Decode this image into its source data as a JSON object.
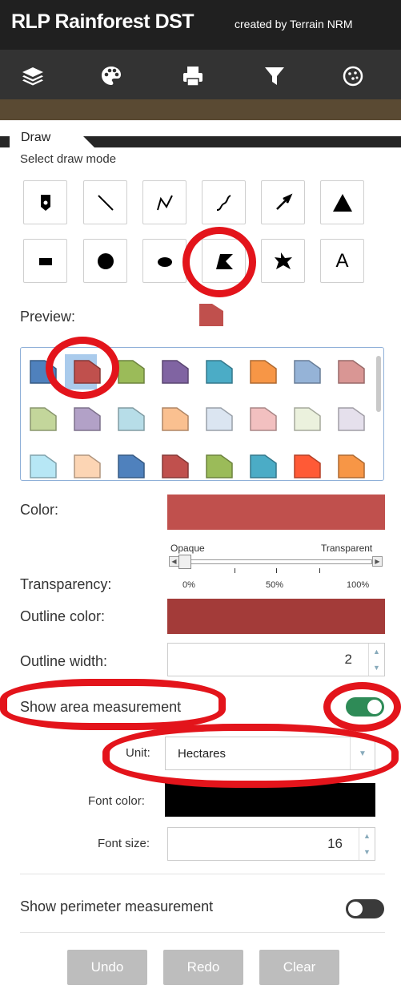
{
  "header": {
    "title": "RLP Rainforest DST",
    "credit": "created by Terrain NRM"
  },
  "toolbar": {
    "icons": [
      "layers-icon",
      "palette-icon",
      "print-icon",
      "filter-icon",
      "analysis-icon"
    ]
  },
  "tab": {
    "label": "Draw"
  },
  "draw": {
    "select_mode_label": "Select draw mode",
    "tools_row1": [
      "point",
      "line",
      "polyline",
      "freehand-polyline",
      "arrow",
      "triangle"
    ],
    "tools_row2": [
      "rectangle",
      "circle",
      "ellipse",
      "polygon",
      "freehand-polygon",
      "text"
    ],
    "text_tool_label": "A",
    "selected_tool": "polygon"
  },
  "preview": {
    "label": "Preview:",
    "color": "#c0504d"
  },
  "swatches": {
    "selected_index": 1,
    "colors": [
      "#4f81bd",
      "#c0504d",
      "#9bbb59",
      "#8064a2",
      "#4bacc6",
      "#f79646",
      "#95b3d7",
      "#d99694",
      "#c3d69b",
      "#b2a1c7",
      "#b7dde8",
      "#fac090",
      "#dbe5f1",
      "#f2c0c0",
      "#ebf1dd",
      "#e5e0ec",
      "#b7e7f5",
      "#fcd5b4",
      "#4f81bd",
      "#c0504d",
      "#9bbb59",
      "#4bacc6",
      "#ff5a36",
      "#f79646"
    ]
  },
  "style": {
    "color_label": "Color:",
    "color_value": "#c0504d",
    "transparency_label": "Transparency:",
    "slider_min_label": "Opaque",
    "slider_max_label": "Transparent",
    "slider_ticks": [
      "0%",
      "50%",
      "100%"
    ],
    "transparency_value": 0,
    "outline_color_label": "Outline color:",
    "outline_color_value": "#a33b39",
    "outline_width_label": "Outline width:",
    "outline_width_value": "2"
  },
  "area": {
    "label": "Show area measurement",
    "enabled": true,
    "unit_label": "Unit:",
    "unit_value": "Hectares",
    "font_color_label": "Font color:",
    "font_color_value": "#000000",
    "font_size_label": "Font size:",
    "font_size_value": "16"
  },
  "perimeter": {
    "label": "Show perimeter measurement",
    "enabled": false
  },
  "actions": {
    "undo": "Undo",
    "redo": "Redo",
    "clear": "Clear"
  },
  "colors": {
    "toggle_on": "#2e8b57",
    "toggle_off": "#3a3a3a",
    "annotation": "#e3141b"
  }
}
